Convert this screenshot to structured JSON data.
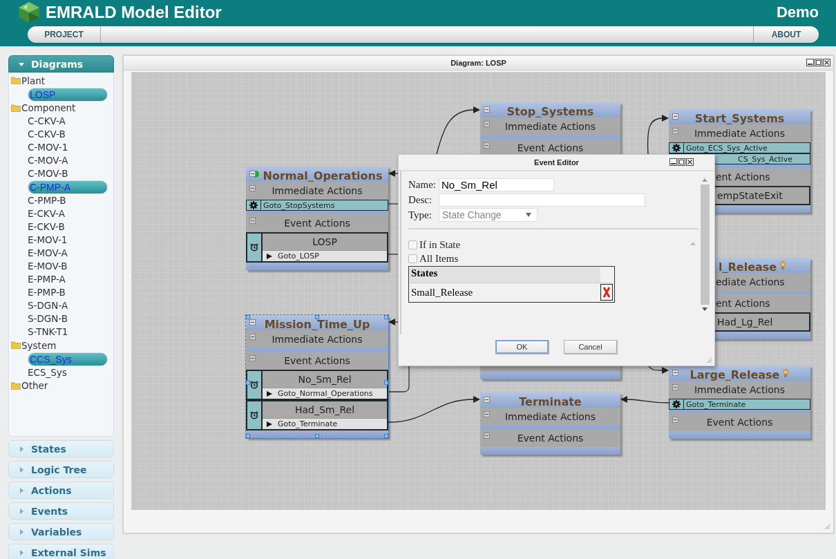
{
  "app": {
    "title": "EMRALD Model Editor",
    "user": "Demo"
  },
  "menu": [
    {
      "label": "PROJECT"
    },
    {
      "label": "ABOUT"
    }
  ],
  "sidebar": [
    {
      "label": "Diagrams",
      "expanded": true,
      "tree": [
        {
          "label": "Plant",
          "children": [
            {
              "label": "LOSP",
              "selected": true
            }
          ]
        },
        {
          "label": "Component",
          "children": [
            {
              "label": "C-CKV-A",
              "selected": false
            },
            {
              "label": "C-CKV-B",
              "selected": false
            },
            {
              "label": "C-MOV-1",
              "selected": false
            },
            {
              "label": "C-MOV-A",
              "selected": false
            },
            {
              "label": "C-MOV-B",
              "selected": false
            },
            {
              "label": "C-PMP-A",
              "selected": true
            },
            {
              "label": "C-PMP-B",
              "selected": false
            },
            {
              "label": "E-CKV-A",
              "selected": false
            },
            {
              "label": "E-CKV-B",
              "selected": false
            },
            {
              "label": "E-MOV-1",
              "selected": false
            },
            {
              "label": "E-MOV-A",
              "selected": false
            },
            {
              "label": "E-MOV-B",
              "selected": false
            },
            {
              "label": "E-PMP-A",
              "selected": false
            },
            {
              "label": "E-PMP-B",
              "selected": false
            },
            {
              "label": "S-DGN-A",
              "selected": false
            },
            {
              "label": "S-DGN-B",
              "selected": false
            },
            {
              "label": "S-TNK-T1",
              "selected": false
            }
          ]
        },
        {
          "label": "System",
          "children": [
            {
              "label": "CCS_Sys",
              "selected": true
            },
            {
              "label": "ECS_Sys",
              "selected": false
            }
          ]
        },
        {
          "label": "Other"
        }
      ]
    },
    {
      "label": "States",
      "expanded": false
    },
    {
      "label": "Logic Tree",
      "expanded": false
    },
    {
      "label": "Actions",
      "expanded": false
    },
    {
      "label": "Events",
      "expanded": false
    },
    {
      "label": "Variables",
      "expanded": false
    },
    {
      "label": "External Sims",
      "expanded": false
    }
  ],
  "diagram": {
    "title": "Diagram: LOSP",
    "nodes": [
      {
        "title": "Normal_Operations",
        "kind": "start",
        "selected": false,
        "rows": [
          {
            "kind": "section",
            "label": "Immediate Actions"
          },
          {
            "kind": "action",
            "label": "Goto_StopSystems"
          },
          {
            "kind": "section",
            "label": "Event Actions"
          },
          {
            "kind": "event",
            "label": "LOSP",
            "action": "Goto_LOSP"
          }
        ]
      },
      {
        "title": "Mission_Time_Up",
        "kind": "standard",
        "selected": true,
        "rows": [
          {
            "kind": "section",
            "label": "Immediate Actions"
          },
          {
            "kind": "section",
            "label": "Event Actions"
          },
          {
            "kind": "event",
            "label": "No_Sm_Rel",
            "action": "Goto_Normal_Operations"
          },
          {
            "kind": "event",
            "label": "Had_Sm_Rel",
            "action": "Goto_Terminate"
          }
        ]
      },
      {
        "title": "Stop_Systems",
        "kind": "standard",
        "selected": false,
        "rows": [
          {
            "kind": "section",
            "label": "Immediate Actions"
          },
          {
            "kind": "section",
            "label": "Event Actions"
          }
        ]
      },
      {
        "title": "Terminate",
        "kind": "standard",
        "selected": false,
        "rows": [
          {
            "kind": "section",
            "label": "Immediate Actions"
          },
          {
            "kind": "section",
            "label": "Event Actions"
          }
        ]
      },
      {
        "title": "Start_Systems",
        "kind": "standard",
        "selected": false,
        "rows": [
          {
            "kind": "section",
            "label": "Immediate Actions"
          },
          {
            "kind": "action",
            "label": "Goto_ECS_Sys_Active"
          },
          {
            "kind": "action",
            "label": "CS_Sys_Active"
          },
          {
            "kind": "section",
            "label": "ent Actions"
          },
          {
            "kind": "event",
            "label": "empStateExit"
          }
        ]
      },
      {
        "title": "l_Release",
        "kind": "key",
        "selected": false,
        "rows": [
          {
            "kind": "section",
            "label": "ediate Actions"
          },
          {
            "kind": "section",
            "label": "ent Actions"
          },
          {
            "kind": "event",
            "label": "Had_Lg_Rel"
          }
        ]
      },
      {
        "title": "Large_Release",
        "kind": "key",
        "selected": false,
        "rows": [
          {
            "kind": "section",
            "label": "Immediate Actions"
          },
          {
            "kind": "action",
            "label": "Goto_Terminate"
          },
          {
            "kind": "section",
            "label": "Event Actions"
          }
        ]
      }
    ]
  },
  "event_editor": {
    "title": "Event Editor",
    "fields": [
      {
        "kind": "text",
        "label": "Name:",
        "value": "No_Sm_Rel"
      },
      {
        "kind": "text",
        "label": "Desc:"
      },
      {
        "kind": "select",
        "label": "Type:",
        "value": "State Change",
        "disabled": true
      }
    ],
    "checkboxes": [
      {
        "label": "If in State",
        "checked": false
      },
      {
        "label": "All Items",
        "checked": false
      }
    ],
    "states_table": {
      "header": "States",
      "rows": [
        "Small_Release"
      ]
    },
    "buttons": [
      {
        "label": "OK",
        "focused": true
      },
      {
        "label": "Cancel",
        "focused": false
      }
    ]
  }
}
